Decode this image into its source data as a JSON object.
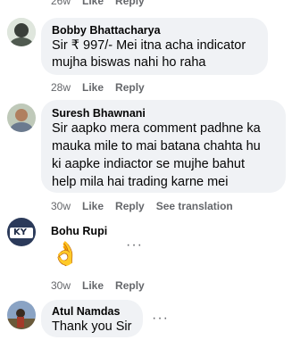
{
  "top_actions": {
    "time": "26w",
    "like": "Like",
    "reply": "Reply"
  },
  "comments": [
    {
      "name": "Bobby Bhattacharya",
      "lines": [
        "Sir ₹ 997/- Mei itna acha indicator",
        "mujha biswas nahi ho raha"
      ],
      "time": "28w",
      "like": "Like",
      "reply": "Reply"
    },
    {
      "name": "Suresh Bhawnani",
      "lines": [
        "Sir aapko mera comment padhne ka",
        "mauka mile to mai batana chahta hu",
        "ki aapke indiactor se mujhe bahut",
        "help mila hai trading karne mei"
      ],
      "time": "30w",
      "like": "Like",
      "reply": "Reply",
      "translate": "See translation"
    },
    {
      "name": "Bohu Rupi",
      "emoji": "👌",
      "time": "30w",
      "like": "Like",
      "reply": "Reply",
      "avatar_text": "KY"
    },
    {
      "name": "Atul Namdas",
      "lines": [
        "Thank you Sir"
      ]
    }
  ],
  "more_glyph": "···",
  "colors": {
    "bubble": "#f0f2f5",
    "secondary_text": "#65676b"
  }
}
